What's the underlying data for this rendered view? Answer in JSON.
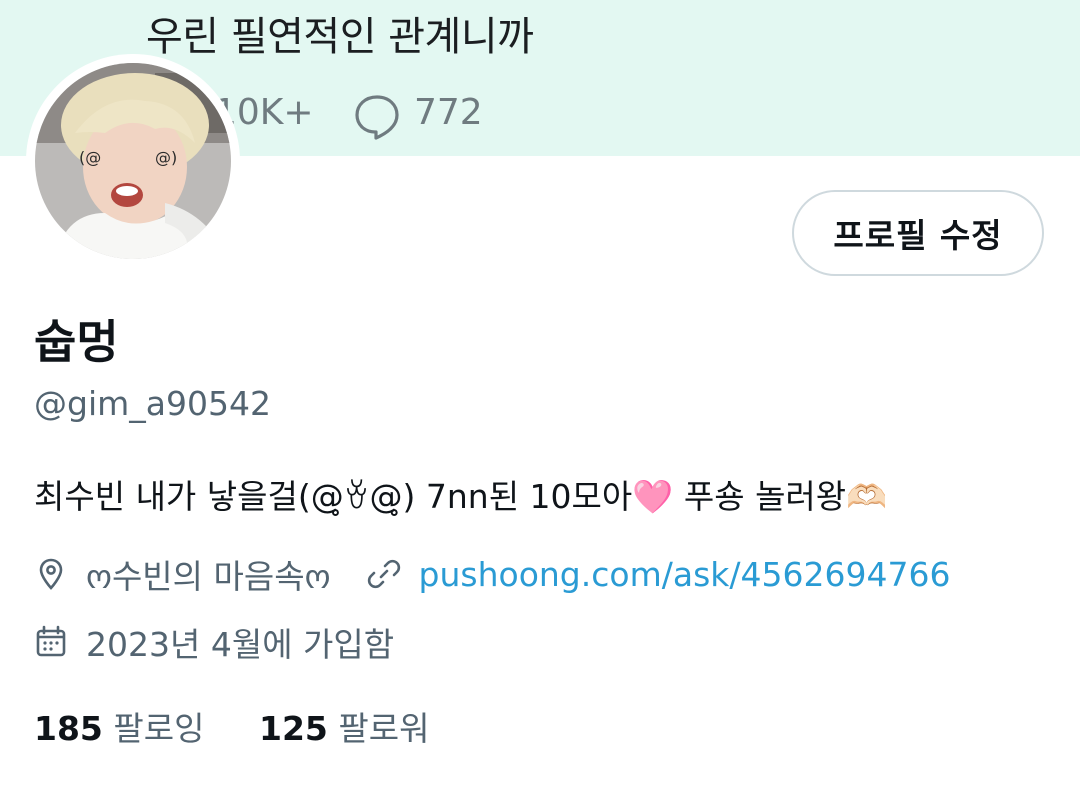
{
  "banner": {
    "text": "우린 필연적인 관계니까",
    "likes": "10K+",
    "comments": "772",
    "background": "#e3f8f2"
  },
  "avatar": {
    "icon": "avatar-photo"
  },
  "profile": {
    "edit_button": "프로필 수정",
    "display_name": "숩멍",
    "handle": "@gim_a90542",
    "bio_text": "최수빈 내가 낳을걸(@̥ꈊ@̥) 7nn된 10모아",
    "bio_heart": "🩷",
    "bio_text2": " 푸숑 놀러왕",
    "bio_hands": "🫶🏻",
    "location": "ო수빈의 마음속ო",
    "website": "pushoong.com/ask/4562694766",
    "joined": "2023년 4월에 가입함",
    "link_color": "#2a9bd4"
  },
  "stats": {
    "following_count": "185",
    "following_label": "팔로잉",
    "followers_count": "125",
    "followers_label": "팔로워"
  }
}
